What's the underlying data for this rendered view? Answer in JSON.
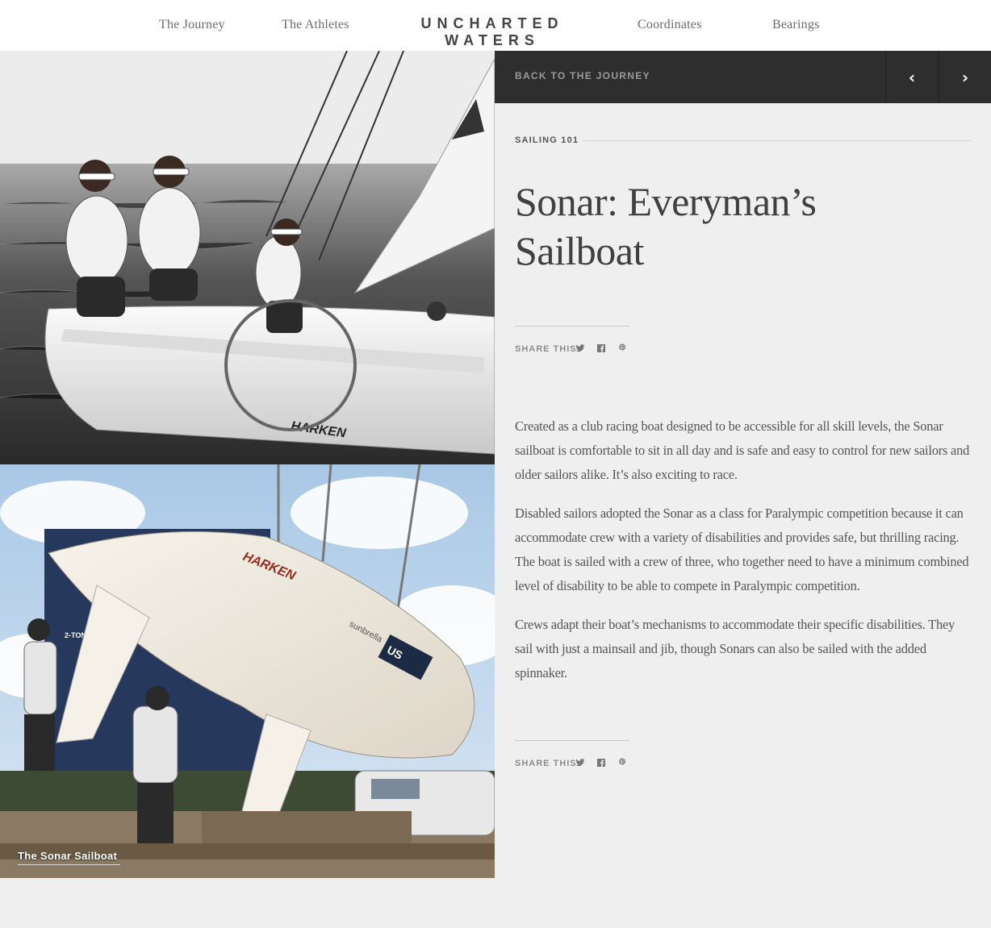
{
  "nav": {
    "links_left": [
      "The Journey",
      "The Athletes"
    ],
    "brand": "UNCHARTED WATERS",
    "links_right": [
      "Coordinates",
      "Bearings"
    ]
  },
  "article_bar": {
    "back_label": "Back to the Journey",
    "prev_icon": "chevron-left-icon",
    "next_icon": "chevron-right-icon"
  },
  "article": {
    "category": "Sailing 101",
    "title": "Sonar: Everyman’s Sailboat",
    "share_label": "Share this:",
    "share_icons": [
      "twitter-icon",
      "facebook-icon",
      "pinterest-icon"
    ],
    "paragraphs": [
      "Created as a club racing boat designed to be accessible for all skill levels, the Sonar sailboat is comfortable to sit in all day and is safe and easy to control for new sailors and older sailors alike. It’s also exciting to race.",
      "Disabled sailors adopted the Sonar as a class for Paralympic competition because it can accommodate crew with a variety of disabilities and provides safe, but thrilling racing. The boat is sailed with a crew of three, who together need to have a minimum combined level of disability to be able to compete in Paralympic competition.",
      "Crews adapt their boat’s mechanisms to accommodate their specific disabilities. They sail with just a mainsail and jib, though Sonars can also be sailed with the added spinnaker."
    ]
  },
  "photos": {
    "top_hull_text": "HARKEN",
    "bottom_hull_text": "HARKEN",
    "bottom_decal_sunbrella": "sunbrella",
    "bottom_decal_us": "US",
    "bottom_caption": "The Sonar Sailboat"
  },
  "colors": {
    "nav_bg": "#ffffff",
    "page_bg": "#efefef",
    "article_bar_bg": "#2e2e2e",
    "title_color": "#404040",
    "body_color": "#555555"
  }
}
